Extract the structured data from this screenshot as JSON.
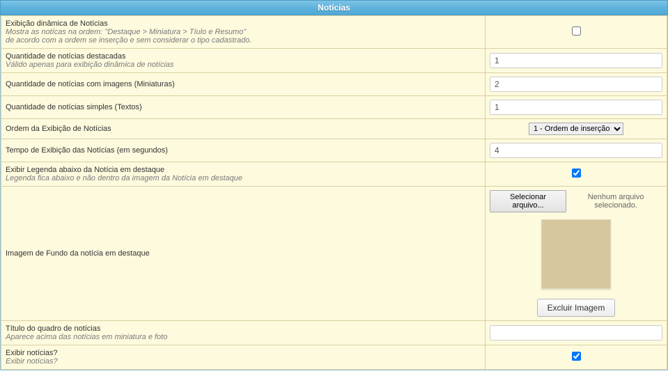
{
  "header": {
    "title": "Notícias"
  },
  "rows": {
    "dynamic": {
      "label": "Exibição dinâmica de Notícias",
      "desc1": "Mostra as notícas na ordem: \"Destaque > Miniatura > Tíulo e Resumo\"",
      "desc2": "de acordo com a ordem se inserção e sem considerar o tipo cadastrado."
    },
    "featured": {
      "label": "Quantidade de notícias destacadas",
      "desc": "Válido apenas para exibição dinâmica de notícias",
      "value": "1"
    },
    "thumbs": {
      "label": "Quantidade de notícias com imagens (Miniaturas)",
      "value": "2"
    },
    "simple": {
      "label": "Quantidade de notícias simples (Textos)",
      "value": "1"
    },
    "order": {
      "label": "Ordem da Exibição de Notícias",
      "selected": "1 - Ordem de inserção"
    },
    "time": {
      "label": "Tempo de Exibição das Notícias (em segundos)",
      "value": "4"
    },
    "legend": {
      "label": "Exibir Legenda abaixo da Notícia em destaque",
      "desc": "Legenda fica abaixo e não dentro da imagem da Notícia em destaque"
    },
    "bgimg": {
      "label": "Imagem de Fundo da notícia em destaque",
      "file_btn": "Selecionar arquivo...",
      "file_none": "Nenhum arquivo selecionado.",
      "delete_btn": "Excluir Imagem"
    },
    "title_box": {
      "label": "Título do quadro de notícias",
      "desc": "Aparece acima das notícias em miniatura e foto",
      "value": ""
    },
    "show": {
      "label": "Exibir notícias?",
      "desc": "Exibir notícias?"
    }
  }
}
